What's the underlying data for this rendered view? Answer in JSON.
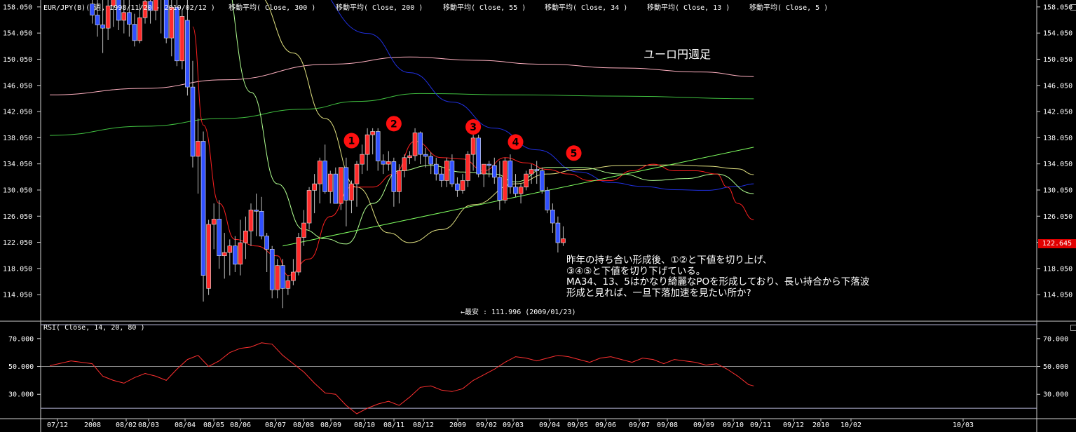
{
  "header": {
    "symbol": "EUR/JPY(B)( 週, 1998/11/20 - 2010/02/12 )",
    "ma300": "移動平均( Close, 300 )",
    "ma200": "移動平均( Close, 200 )",
    "ma55": "移動平均( Close, 55 )",
    "ma34": "移動平均( Close, 34 )",
    "ma13": "移動平均( Close, 13 )",
    "ma5": "移動平均( Close, 5 )"
  },
  "chart_title_jp": "ユーロ円週足",
  "low_annotation": "←最安 : 111.996 (2009/01/23)",
  "note_lines": [
    "昨年の持ち合い形成後、①②と下値を切り上げ、",
    "③④⑤と下値を切り下げている。",
    "MA34、13、5はかなり綺麗なPOを形成しており、長い持合から下落波",
    "形成と見れば、一旦下落加速を見たい所か?"
  ],
  "markers": [
    "1",
    "2",
    "3",
    "4",
    "5"
  ],
  "rsi_header": "RSI( Close, 14, 20, 80 )",
  "current_price": "122.645",
  "colors": {
    "background": "#000000",
    "bull": "#ff2a2a",
    "bear": "#3050ff",
    "ma300": "#ffb0c0",
    "ma200": "#40c040",
    "ma55": "#2030e0",
    "ma34": "#e0e080",
    "ma13": "#b0ff90",
    "ma5": "#ff2020",
    "rsi": "#ff3030",
    "trendline": "#80ff60",
    "marker": "#ff1010"
  },
  "chart_data": {
    "type": "candlestick",
    "title": "EUR/JPY(B)( 週, 1998/11/20 - 2010/02/12 )",
    "y_ticks": [
      "158.050",
      "154.050",
      "150.050",
      "146.050",
      "142.050",
      "138.050",
      "134.050",
      "130.050",
      "126.050",
      "122.050",
      "118.050",
      "114.050"
    ],
    "ylim": [
      110.1,
      159.0
    ],
    "rsi_ticks": [
      "70.000",
      "50.000",
      "30.000"
    ],
    "rsi_ylim": [
      13,
      82
    ],
    "rsi_levels": [
      80,
      20
    ],
    "x_labels": [
      "07/12",
      "2008",
      "08/02",
      "08/03",
      "08/04",
      "08/05",
      "08/06",
      "08/07",
      "08/08",
      "08/09",
      "08/10",
      "08/11",
      "08/12",
      "2009",
      "09/02",
      "09/03",
      "09/04",
      "09/05",
      "09/06",
      "09/07",
      "09/08",
      "09/09",
      "09/10",
      "09/11",
      "09/12",
      "2010",
      "10/02",
      "10/03"
    ],
    "candles": [
      [
        158.5,
        160.5,
        155.5,
        156.8
      ],
      [
        156.8,
        161.5,
        153.5,
        155.3
      ],
      [
        155.3,
        160.0,
        151.0,
        154.8
      ],
      [
        154.8,
        161.0,
        153.0,
        158.2
      ],
      [
        158.2,
        161.5,
        155.0,
        159.5
      ],
      [
        159.5,
        162.0,
        154.5,
        156.0
      ],
      [
        156.0,
        159.5,
        154.0,
        157.2
      ],
      [
        157.2,
        160.0,
        153.5,
        155.4
      ],
      [
        155.4,
        157.0,
        152.0,
        152.9
      ],
      [
        152.9,
        158.5,
        152.5,
        156.4
      ],
      [
        156.4,
        161.0,
        155.5,
        158.9
      ],
      [
        158.9,
        162.0,
        155.5,
        157.5
      ],
      [
        157.5,
        161.0,
        156.0,
        159.2
      ],
      [
        159.2,
        163.0,
        154.0,
        160.0
      ],
      [
        160.5,
        161.0,
        152.5,
        153.3
      ],
      [
        153.3,
        159.5,
        150.5,
        158.0
      ],
      [
        158.0,
        160.0,
        149.0,
        149.8
      ],
      [
        149.8,
        157.5,
        148.5,
        156.6
      ],
      [
        156.0,
        160.5,
        144.5,
        145.8
      ],
      [
        145.8,
        149.8,
        133.5,
        135.2
      ],
      [
        135.2,
        141.0,
        129.5,
        137.5
      ],
      [
        137.5,
        139.0,
        113.0,
        117.0
      ],
      [
        115.0,
        125.5,
        114.0,
        124.8
      ],
      [
        124.8,
        128.0,
        121.0,
        125.6
      ],
      [
        125.6,
        128.5,
        118.0,
        120.0
      ],
      [
        120.0,
        123.5,
        116.5,
        120.5
      ],
      [
        120.5,
        122.5,
        117.0,
        121.5
      ],
      [
        121.5,
        123.0,
        117.5,
        118.7
      ],
      [
        118.7,
        125.5,
        117.0,
        122.0
      ],
      [
        122.0,
        126.0,
        119.5,
        123.8
      ],
      [
        123.8,
        128.0,
        121.5,
        127.0
      ],
      [
        127.0,
        129.5,
        123.0,
        126.8
      ],
      [
        126.8,
        129.0,
        122.5,
        123.0
      ],
      [
        123.0,
        123.5,
        117.5,
        121.0
      ],
      [
        121.0,
        121.5,
        113.5,
        114.8
      ],
      [
        114.8,
        119.5,
        113.5,
        118.5
      ],
      [
        118.5,
        119.5,
        112.0,
        115.0
      ],
      [
        115.0,
        117.0,
        114.0,
        116.2
      ],
      [
        116.2,
        119.5,
        115.5,
        117.5
      ],
      [
        117.5,
        123.5,
        117.0,
        122.8
      ],
      [
        122.8,
        127.0,
        121.5,
        125.0
      ],
      [
        125.0,
        130.5,
        124.0,
        130.0
      ],
      [
        130.0,
        132.5,
        126.5,
        131.0
      ],
      [
        131.0,
        135.0,
        128.0,
        134.5
      ],
      [
        134.5,
        137.0,
        129.5,
        129.8
      ],
      [
        129.8,
        133.0,
        128.0,
        132.5
      ],
      [
        132.5,
        133.5,
        128.5,
        128.0
      ],
      [
        128.0,
        133.0,
        127.0,
        133.5
      ],
      [
        133.5,
        135.0,
        124.5,
        128.5
      ],
      [
        128.5,
        131.5,
        126.5,
        131.0
      ],
      [
        131.0,
        134.5,
        127.5,
        134.0
      ],
      [
        134.0,
        137.0,
        132.5,
        135.5
      ],
      [
        135.5,
        139.5,
        133.0,
        138.5
      ],
      [
        138.5,
        139.5,
        135.5,
        139.0
      ],
      [
        139.0,
        139.5,
        133.0,
        134.5
      ],
      [
        134.5,
        135.5,
        132.5,
        134.0
      ],
      [
        134.0,
        136.0,
        133.0,
        134.4
      ],
      [
        134.4,
        135.0,
        127.5,
        129.8
      ],
      [
        129.8,
        134.0,
        128.0,
        133.0
      ],
      [
        133.0,
        135.5,
        132.0,
        135.0
      ],
      [
        135.0,
        136.0,
        134.0,
        135.3
      ],
      [
        135.3,
        139.5,
        134.5,
        138.8
      ],
      [
        138.8,
        139.0,
        134.0,
        135.5
      ],
      [
        135.5,
        136.5,
        133.5,
        135.2
      ],
      [
        135.2,
        135.8,
        132.5,
        134.0
      ],
      [
        134.0,
        135.0,
        131.5,
        132.5
      ],
      [
        132.5,
        133.5,
        130.5,
        131.5
      ],
      [
        131.5,
        135.0,
        130.5,
        134.5
      ],
      [
        134.5,
        135.5,
        130.5,
        131.0
      ],
      [
        131.0,
        132.0,
        129.0,
        130.0
      ],
      [
        130.0,
        132.5,
        129.5,
        131.5
      ],
      [
        131.5,
        136.0,
        130.5,
        135.5
      ],
      [
        135.5,
        138.5,
        133.0,
        138.0
      ],
      [
        138.0,
        138.5,
        132.0,
        132.5
      ],
      [
        132.5,
        134.0,
        130.5,
        134.0
      ],
      [
        134.0,
        134.5,
        132.0,
        133.8
      ],
      [
        133.8,
        135.0,
        131.0,
        132.0
      ],
      [
        132.0,
        134.5,
        127.0,
        128.5
      ],
      [
        128.5,
        135.0,
        128.0,
        134.5
      ],
      [
        134.5,
        135.5,
        129.5,
        130.5
      ],
      [
        130.5,
        132.5,
        129.0,
        129.5
      ],
      [
        129.5,
        131.0,
        128.0,
        130.5
      ],
      [
        130.5,
        133.0,
        130.0,
        132.5
      ],
      [
        132.5,
        134.0,
        131.0,
        133.2
      ],
      [
        133.2,
        134.5,
        131.0,
        133.0
      ],
      [
        133.0,
        133.5,
        129.5,
        130.0
      ],
      [
        130.0,
        130.5,
        126.5,
        127.0
      ],
      [
        127.0,
        128.0,
        123.5,
        125.0
      ],
      [
        125.0,
        126.0,
        120.5,
        122.0
      ],
      [
        122.0,
        124.5,
        121.5,
        122.6
      ]
    ],
    "series": [
      {
        "key": "ma300",
        "points": [
          [
            -8,
            144.6
          ],
          [
            10,
            145.6
          ],
          [
            25,
            146.9
          ],
          [
            45,
            149.3
          ],
          [
            60,
            150.4
          ],
          [
            72,
            149.9
          ],
          [
            85,
            149.3
          ],
          [
            100,
            148.7
          ],
          [
            115,
            148.1
          ],
          [
            125,
            147.4
          ]
        ]
      },
      {
        "key": "ma200",
        "points": [
          [
            -8,
            138.4
          ],
          [
            10,
            139.8
          ],
          [
            25,
            141.0
          ],
          [
            40,
            142.4
          ],
          [
            50,
            143.6
          ],
          [
            62,
            144.8
          ],
          [
            80,
            144.6
          ],
          [
            100,
            144.4
          ],
          [
            125,
            144.0
          ]
        ]
      },
      {
        "key": "ma55",
        "points": [
          [
            40,
            162.0
          ],
          [
            52,
            154.0
          ],
          [
            60,
            148.0
          ],
          [
            68,
            143.5
          ],
          [
            76,
            139.5
          ],
          [
            84,
            136.2
          ],
          [
            92,
            132.8
          ],
          [
            98,
            131.2
          ],
          [
            104,
            130.6
          ],
          [
            110,
            130.1
          ],
          [
            116,
            130.0
          ],
          [
            122,
            130.6
          ],
          [
            125,
            131.0
          ]
        ]
      },
      {
        "key": "ma34",
        "points": [
          [
            31,
            160.0
          ],
          [
            38,
            151.0
          ],
          [
            44,
            141.0
          ],
          [
            50,
            130.5
          ],
          [
            56,
            123.5
          ],
          [
            60,
            122.0
          ],
          [
            66,
            124.0
          ],
          [
            72,
            127.8
          ],
          [
            80,
            131.0
          ],
          [
            86,
            132.5
          ],
          [
            92,
            133.2
          ],
          [
            100,
            133.8
          ],
          [
            110,
            133.9
          ],
          [
            116,
            133.7
          ],
          [
            122,
            133.3
          ],
          [
            125,
            132.4
          ]
        ]
      },
      {
        "key": "ma13",
        "points": [
          [
            24,
            166.0
          ],
          [
            30,
            145.0
          ],
          [
            35,
            131.0
          ],
          [
            40,
            124.0
          ],
          [
            44,
            122.6
          ],
          [
            48,
            121.8
          ],
          [
            53,
            128.0
          ],
          [
            58,
            133.0
          ],
          [
            64,
            133.8
          ],
          [
            70,
            132.8
          ],
          [
            76,
            132.5
          ],
          [
            80,
            131.3
          ],
          [
            86,
            133.5
          ],
          [
            92,
            133.5
          ],
          [
            100,
            132.5
          ],
          [
            106,
            131.5
          ],
          [
            112,
            131.8
          ],
          [
            118,
            132.5
          ],
          [
            125,
            129.5
          ]
        ]
      },
      {
        "key": "ma5",
        "points": [
          [
            19,
            155.0
          ],
          [
            21,
            140.0
          ],
          [
            24,
            128.0
          ],
          [
            27,
            122.5
          ],
          [
            31,
            121.5
          ],
          [
            35,
            120.0
          ],
          [
            37,
            117.0
          ],
          [
            41,
            119.5
          ],
          [
            45,
            126.0
          ],
          [
            49,
            130.5
          ],
          [
            53,
            130.5
          ],
          [
            57,
            132.5
          ],
          [
            61,
            137.5
          ],
          [
            66,
            135.0
          ],
          [
            70,
            134.8
          ],
          [
            74,
            133.0
          ],
          [
            78,
            135.0
          ],
          [
            82,
            134.2
          ],
          [
            86,
            133.2
          ],
          [
            90,
            132.5
          ],
          [
            94,
            131.5
          ],
          [
            98,
            131.5
          ],
          [
            102,
            133.0
          ],
          [
            106,
            134.0
          ],
          [
            110,
            133.0
          ],
          [
            114,
            133.0
          ],
          [
            118,
            132.5
          ],
          [
            120,
            130.5
          ],
          [
            122,
            128.0
          ],
          [
            125,
            125.5
          ]
        ]
      },
      {
        "key": "trendline",
        "points": [
          [
            36,
            121.5
          ],
          [
            125,
            136.6
          ]
        ]
      }
    ],
    "rsi": [
      [
        -8,
        50.5
      ],
      [
        -4,
        54
      ],
      [
        0,
        52
      ],
      [
        2,
        43
      ],
      [
        4,
        40
      ],
      [
        6,
        38
      ],
      [
        8,
        42
      ],
      [
        10,
        45
      ],
      [
        12,
        43
      ],
      [
        14,
        40
      ],
      [
        16,
        48
      ],
      [
        18,
        55
      ],
      [
        20,
        58
      ],
      [
        22,
        50
      ],
      [
        24,
        54
      ],
      [
        26,
        60
      ],
      [
        28,
        63
      ],
      [
        30,
        64
      ],
      [
        32,
        67
      ],
      [
        34,
        66
      ],
      [
        36,
        58
      ],
      [
        38,
        52
      ],
      [
        40,
        46
      ],
      [
        42,
        38
      ],
      [
        44,
        31
      ],
      [
        46,
        30
      ],
      [
        48,
        22
      ],
      [
        50,
        16
      ],
      [
        52,
        20
      ],
      [
        54,
        23
      ],
      [
        56,
        25
      ],
      [
        58,
        22
      ],
      [
        60,
        28
      ],
      [
        62,
        35
      ],
      [
        64,
        36
      ],
      [
        66,
        33
      ],
      [
        68,
        32
      ],
      [
        70,
        34
      ],
      [
        72,
        40
      ],
      [
        74,
        44
      ],
      [
        76,
        48
      ],
      [
        78,
        53
      ],
      [
        80,
        57
      ],
      [
        82,
        56
      ],
      [
        84,
        54
      ],
      [
        86,
        56
      ],
      [
        88,
        58
      ],
      [
        90,
        57
      ],
      [
        92,
        55
      ],
      [
        94,
        53
      ],
      [
        96,
        56
      ],
      [
        98,
        57
      ],
      [
        100,
        55
      ],
      [
        102,
        53
      ],
      [
        104,
        56
      ],
      [
        106,
        55
      ],
      [
        108,
        52
      ],
      [
        110,
        55
      ],
      [
        112,
        54
      ],
      [
        114,
        53
      ],
      [
        116,
        51
      ],
      [
        118,
        52
      ],
      [
        120,
        48
      ],
      [
        122,
        43
      ],
      [
        124,
        37
      ],
      [
        125,
        36
      ]
    ],
    "marker_positions": [
      [
        49,
        137.6,
        "1"
      ],
      [
        57,
        140.2,
        "2"
      ],
      [
        72,
        139.7,
        "3"
      ],
      [
        80,
        137.4,
        "4"
      ],
      [
        91,
        135.7,
        "5"
      ]
    ]
  }
}
